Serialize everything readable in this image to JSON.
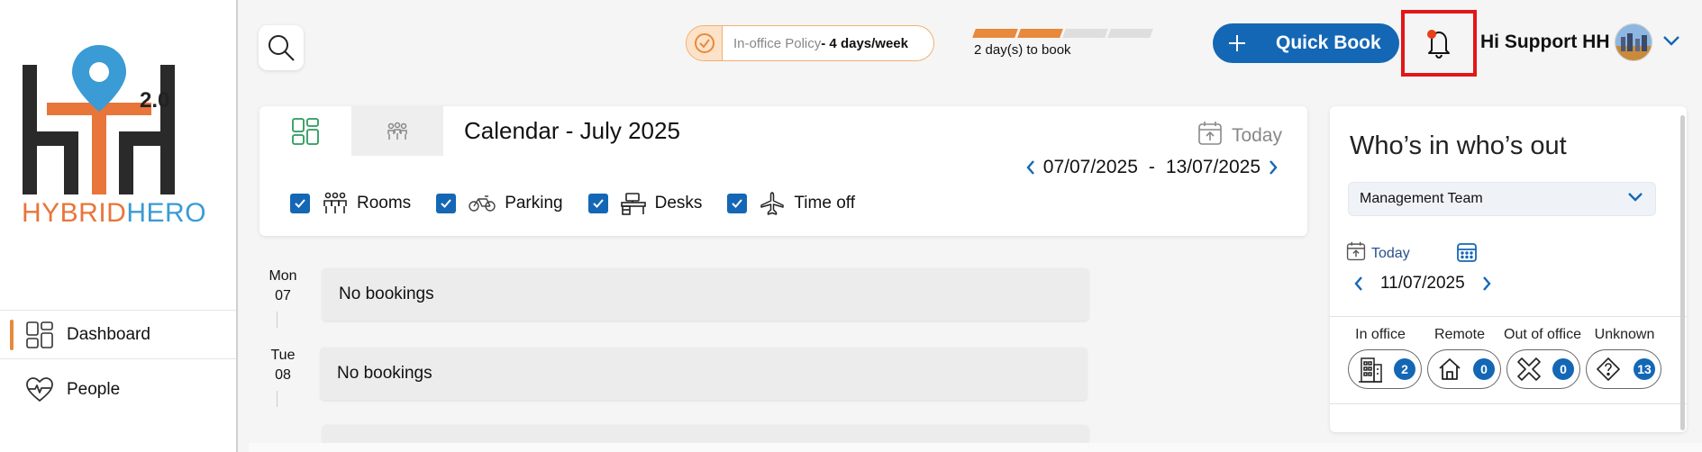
{
  "brand": {
    "logo_part1": "HYBRID",
    "logo_part2": "HERO",
    "logo_version": "2.0",
    "accent_orange": "#e8893c",
    "accent_blue": "#1467b5"
  },
  "sidebar": {
    "items": [
      {
        "label": "Dashboard",
        "icon": "grid-icon",
        "active": true
      },
      {
        "label": "People",
        "icon": "heartbeat-icon",
        "active": false
      }
    ]
  },
  "topbar": {
    "policy_label": "In-office Policy",
    "policy_value": "- 4 days/week",
    "progress_filled": 2,
    "progress_total": 4,
    "progress_label": "2 day(s) to book",
    "quick_book_label": "Quick Book",
    "user_greeting": "Hi Support HH"
  },
  "calendar": {
    "title": "Calendar - July 2025",
    "today_label": "Today",
    "range_start": "07/07/2025",
    "range_sep": "-",
    "range_end": "13/07/2025",
    "filters": [
      {
        "label": "Rooms",
        "checked": true,
        "icon": "people-room-icon"
      },
      {
        "label": "Parking",
        "checked": true,
        "icon": "bicycle-icon"
      },
      {
        "label": "Desks",
        "checked": true,
        "icon": "desk-icon"
      },
      {
        "label": "Time off",
        "checked": true,
        "icon": "airplane-icon"
      }
    ],
    "days": [
      {
        "weekday": "Mon",
        "date": "07",
        "text": "No bookings"
      },
      {
        "weekday": "Tue",
        "date": "08",
        "text": "No bookings"
      }
    ]
  },
  "who": {
    "title": "Who’s in who’s out",
    "team": "Management Team",
    "today_label": "Today",
    "date": "11/07/2025",
    "stats": [
      {
        "label": "In office",
        "count": "2",
        "icon": "building-icon"
      },
      {
        "label": "Remote",
        "count": "0",
        "icon": "home-icon"
      },
      {
        "label": "Out of office",
        "count": "0",
        "icon": "cross-icon"
      },
      {
        "label": "Unknown",
        "count": "13",
        "icon": "question-diamond-icon"
      }
    ]
  }
}
